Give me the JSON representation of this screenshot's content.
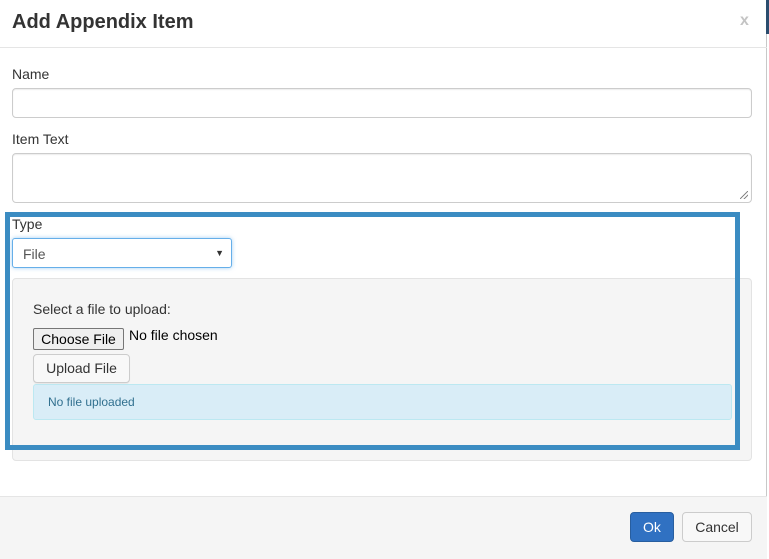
{
  "dialog": {
    "title": "Add Appendix Item",
    "close_label": "x"
  },
  "form": {
    "name_label": "Name",
    "name_value": "",
    "item_text_label": "Item Text",
    "item_text_value": "",
    "type_label": "Type",
    "type_selected": "File"
  },
  "upload": {
    "prompt": "Select a file to upload:",
    "choose_button": "Choose File",
    "chosen_status": "No file chosen",
    "upload_button": "Upload File",
    "status_message": "No file uploaded"
  },
  "footer": {
    "ok_label": "Ok",
    "cancel_label": "Cancel"
  },
  "colors": {
    "primary": "#3071c2",
    "highlight_border": "#3b8cc2",
    "info_background": "#d9edf7",
    "info_text": "#31708f"
  }
}
